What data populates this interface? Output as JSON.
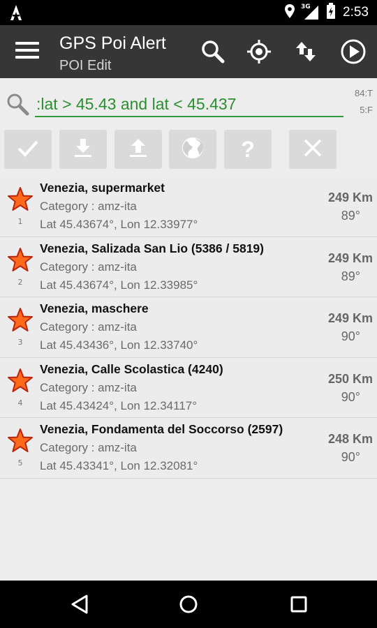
{
  "status_bar": {
    "time": "2:53",
    "network": "3G",
    "icons": [
      "app-notification-icon",
      "location-icon",
      "signal-icon",
      "battery-icon"
    ]
  },
  "app_bar": {
    "title": "GPS Poi Alert",
    "subtitle": "POI Edit",
    "actions": [
      "search-icon",
      "my-location-icon",
      "sort-icon",
      "play-icon"
    ]
  },
  "search": {
    "query": ":lat > 45.43 and lat < 45.437",
    "side_top": "84:T",
    "side_bottom": "5:F"
  },
  "toolbar": {
    "buttons": [
      "check-icon",
      "download-icon",
      "upload-icon",
      "globe-icon",
      "help-icon",
      "close-icon"
    ]
  },
  "pois": [
    {
      "index": "1",
      "name": "Venezia, supermarket",
      "category": "Category : amz-ita",
      "coords": "Lat 45.43674°, Lon 12.33977°",
      "distance": "249 Km",
      "bearing": "89°"
    },
    {
      "index": "2",
      "name": "Venezia, Salizada San Lio (5386 / 5819)",
      "category": "Category : amz-ita",
      "coords": "Lat 45.43674°, Lon 12.33985°",
      "distance": "249 Km",
      "bearing": "89°"
    },
    {
      "index": "3",
      "name": "Venezia, maschere",
      "category": "Category : amz-ita",
      "coords": "Lat 45.43436°, Lon 12.33740°",
      "distance": "249 Km",
      "bearing": "90°"
    },
    {
      "index": "4",
      "name": "Venezia, Calle Scolastica (4240)",
      "category": "Category : amz-ita",
      "coords": "Lat 45.43424°, Lon 12.34117°",
      "distance": "250 Km",
      "bearing": "90°"
    },
    {
      "index": "5",
      "name": "Venezia, Fondamenta del Soccorso (2597)",
      "category": "Category : amz-ita",
      "coords": "Lat 45.43341°, Lon 12.32081°",
      "distance": "248 Km",
      "bearing": "90°"
    }
  ],
  "nav_bar": {
    "buttons": [
      "back-icon",
      "home-icon",
      "recents-icon"
    ]
  },
  "colors": {
    "app_bar": "#363636",
    "accent_green": "#2b8f2f",
    "star_fill": "#ff6a1a",
    "star_stroke": "#b8260f"
  }
}
